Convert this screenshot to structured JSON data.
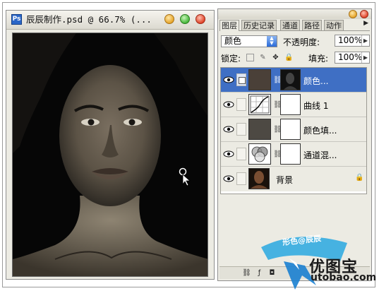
{
  "document_window": {
    "title": "辰辰制作.psd @ 66.7% (...",
    "icon": "photoshop-document-icon"
  },
  "layers_panel": {
    "tabs": [
      {
        "label": "图层",
        "active": true
      },
      {
        "label": "历史记录",
        "active": false
      },
      {
        "label": "通道",
        "active": false
      },
      {
        "label": "路径",
        "active": false
      },
      {
        "label": "动作",
        "active": false
      }
    ],
    "blend_mode": "颜色",
    "opacity_label": "不透明度:",
    "opacity_value": "100%",
    "lock_label": "锁定:",
    "fill_label": "填充:",
    "fill_value": "100%",
    "layers": [
      {
        "name": "颜色...",
        "type": "solid-color-fill",
        "selected": true,
        "visible": true,
        "thumb_color": "#4a4038"
      },
      {
        "name": "曲线 1",
        "type": "curves-adjustment",
        "selected": false,
        "visible": true
      },
      {
        "name": "颜色填...",
        "type": "solid-color-fill",
        "selected": false,
        "visible": true,
        "thumb_color": "#4d4943"
      },
      {
        "name": "通道混...",
        "type": "channel-mixer-adjustment",
        "selected": false,
        "visible": true
      },
      {
        "name": "背景",
        "type": "background",
        "selected": false,
        "visible": true,
        "locked": true
      }
    ]
  },
  "watermark": {
    "logo_text": "优图宝",
    "url": "utobao.com",
    "stamp": "形色@辰辰"
  },
  "colors": {
    "selection_blue": "#3f6fc4",
    "panel_bg": "#ecebe3"
  }
}
